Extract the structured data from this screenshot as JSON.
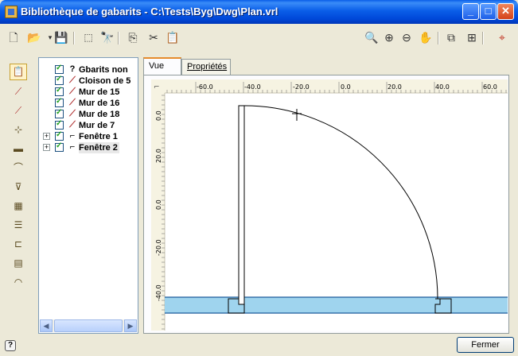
{
  "window": {
    "title": "Bibliothèque de gabarits - C:\\Tests\\Byg\\Dwg\\Plan.vrl",
    "min_glyph": "_",
    "max_glyph": "□",
    "close_glyph": "✕"
  },
  "toolbar": {
    "icons": [
      "new-icon",
      "open-icon",
      "dropdown-icon",
      "save-icon",
      "rectangle-select-icon",
      "find-icon",
      "copy-icon",
      "cut-icon",
      "paste-icon",
      "zoom-extents-icon",
      "zoom-in-icon",
      "zoom-out-icon",
      "pan-hand-icon",
      "insert-icon",
      "grid-icon",
      "snap-point-icon"
    ]
  },
  "left_tools": [
    "properties-tool",
    "wall-tool",
    "wall-tool-2",
    "column-tool",
    "beam-tool",
    "door-tool",
    "window-tool",
    "pattern-tool",
    "stair-tool",
    "dimension-tool",
    "table-tool",
    "arc-tool"
  ],
  "tree": {
    "items": [
      {
        "label": "Gbarits non",
        "icon": "?",
        "expander": ""
      },
      {
        "label": "Cloison de 5",
        "icon": "wall",
        "expander": ""
      },
      {
        "label": "Mur de 15",
        "icon": "wall",
        "expander": ""
      },
      {
        "label": "Mur de 16",
        "icon": "wall",
        "expander": ""
      },
      {
        "label": "Mur de 18",
        "icon": "wall",
        "expander": ""
      },
      {
        "label": "Mur de 7",
        "icon": "wall",
        "expander": ""
      },
      {
        "label": "Fenêtre 1",
        "icon": "door",
        "expander": "+"
      },
      {
        "label": "Fenêtre 2",
        "icon": "door",
        "expander": "+"
      }
    ]
  },
  "tabs": [
    {
      "label": "Vue",
      "active": true
    },
    {
      "label": "Propriétés",
      "active": false
    }
  ],
  "ruler": {
    "x_labels": [
      "-60.0",
      "-40.0",
      "-20.0",
      "0.0",
      "20.0",
      "40.0",
      "60.0"
    ],
    "y_labels": [
      "0.0",
      "20.0",
      "0.0",
      "-20.0",
      "-40.0"
    ]
  },
  "footer": {
    "help_label": "?",
    "close_label": "Fermer"
  },
  "colors": {
    "title_blue": "#0a5ee8",
    "wall_band": "#9fd4ee",
    "wall_line": "#1c5a9a"
  }
}
